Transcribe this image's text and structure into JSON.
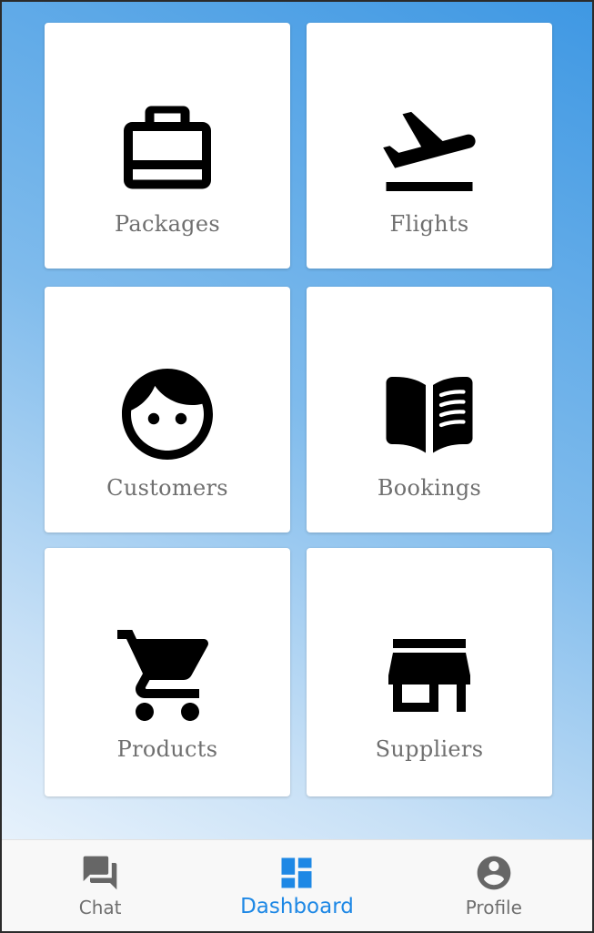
{
  "colors": {
    "accent": "#1e88e5",
    "tile_background": "#ffffff",
    "tile_label": "#6f6f6f",
    "icon": "#000000",
    "nav_inactive": "#666666",
    "nav_background": "#f8f8f8"
  },
  "tiles": [
    {
      "label": "Packages",
      "icon": "briefcase-icon"
    },
    {
      "label": "Flights",
      "icon": "flight-takeoff-icon"
    },
    {
      "label": "Customers",
      "icon": "face-icon"
    },
    {
      "label": "Bookings",
      "icon": "open-book-icon"
    },
    {
      "label": "Products",
      "icon": "shopping-cart-icon"
    },
    {
      "label": "Suppliers",
      "icon": "store-icon"
    }
  ],
  "bottom_nav": {
    "items": [
      {
        "label": "Chat",
        "icon": "chat-icon",
        "active": false
      },
      {
        "label": "Dashboard",
        "icon": "dashboard-icon",
        "active": true
      },
      {
        "label": "Profile",
        "icon": "account-circle-icon",
        "active": false
      }
    ]
  }
}
